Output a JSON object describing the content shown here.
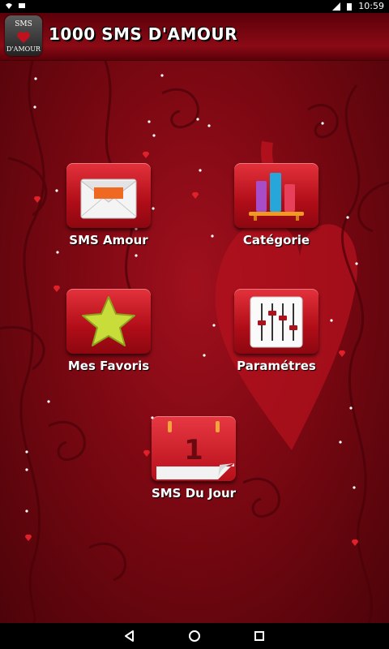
{
  "status": {
    "time": "10:59"
  },
  "app": {
    "title": "1000 SMS D'AMOUR",
    "logo_top": "SMS",
    "logo_bottom": "D'AMOUR"
  },
  "menu": {
    "sms_amour": "SMS Amour",
    "categorie": "Catégorie",
    "favoris": "Mes Favoris",
    "parametres": "Paramétres",
    "du_jour": "SMS Du Jour",
    "calendar_day": "1"
  },
  "colors": {
    "accent_red": "#c0121e",
    "dark_red": "#6a0710",
    "star": "#c9dd3a"
  }
}
